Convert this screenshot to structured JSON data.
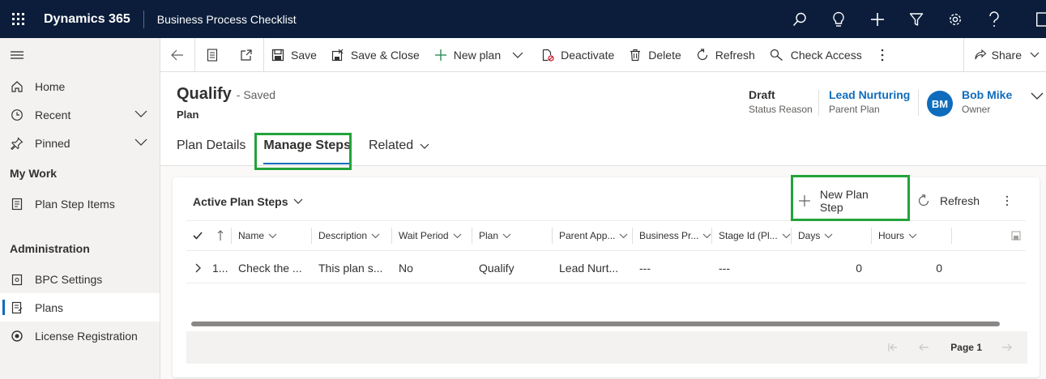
{
  "topbar": {
    "app_name": "Dynamics 365",
    "app_title": "Business Process Checklist",
    "icons": [
      "search-icon",
      "lightbulb-icon",
      "plus-icon",
      "filter-icon",
      "gear-icon",
      "help-icon",
      "chat-icon"
    ]
  },
  "sidebar": {
    "items": [
      {
        "label": "Home",
        "icon": "home-icon"
      },
      {
        "label": "Recent",
        "icon": "clock-icon"
      },
      {
        "label": "Pinned",
        "icon": "pin-icon"
      }
    ],
    "section_mywork": "My Work",
    "mywork_items": [
      {
        "label": "Plan Step Items",
        "icon": "checklist-icon"
      }
    ],
    "section_admin": "Administration",
    "admin_items": [
      {
        "label": "BPC Settings",
        "icon": "settings-icon"
      },
      {
        "label": "Plans",
        "icon": "document-icon"
      },
      {
        "label": "License Registration",
        "icon": "license-icon"
      }
    ]
  },
  "commandbar": {
    "save": "Save",
    "save_close": "Save & Close",
    "new_plan": "New plan",
    "deactivate": "Deactivate",
    "delete": "Delete",
    "refresh": "Refresh",
    "check_access": "Check Access",
    "share": "Share"
  },
  "header": {
    "title": "Qualify",
    "saved_status": "- Saved",
    "entity": "Plan",
    "status_reason_value": "Draft",
    "status_reason_label": "Status Reason",
    "parent_plan_value": "Lead Nurturing",
    "parent_plan_label": "Parent Plan",
    "owner_initials": "BM",
    "owner_value": "Bob Mike",
    "owner_label": "Owner"
  },
  "tabs": [
    "Plan Details",
    "Manage Steps",
    "Related"
  ],
  "grid": {
    "title": "Active Plan Steps",
    "new_button": "New Plan Step",
    "refresh_button": "Refresh",
    "columns": [
      "Name",
      "Description",
      "Wait Period",
      "Plan",
      "Parent App...",
      "Business Pr...",
      "Stage Id (Pl...",
      "Days",
      "Hours"
    ],
    "rows": [
      {
        "order": "1...",
        "name": "Check the ...",
        "description": "This plan s...",
        "wait_period": "No",
        "plan": "Qualify",
        "parent": "Lead Nurt...",
        "business": "---",
        "stage": "---",
        "days": "0",
        "hours": "0"
      }
    ],
    "page_label": "Page 1"
  },
  "colors": {
    "topbar": "#0b1d3a",
    "accent": "#0f6cbd",
    "highlight": "#22a33a"
  }
}
